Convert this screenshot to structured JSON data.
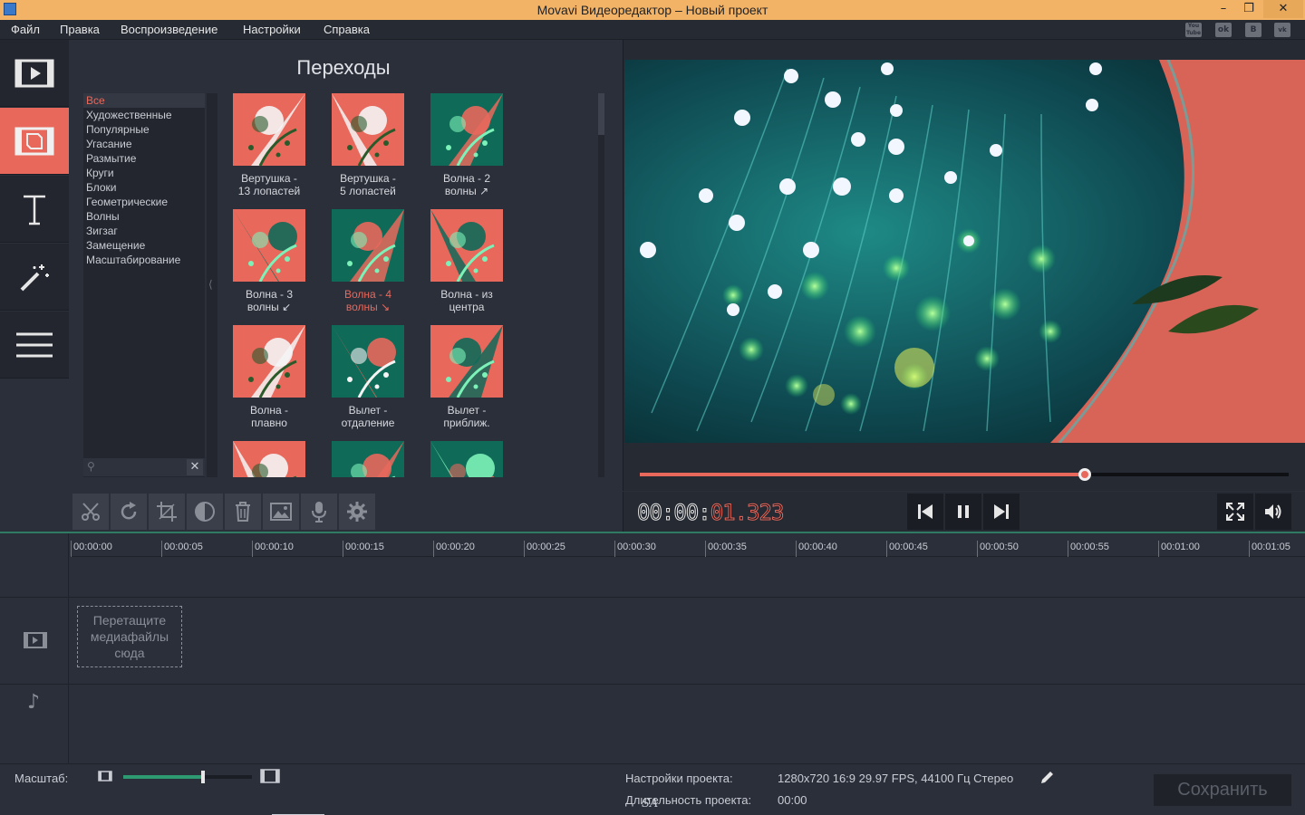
{
  "window": {
    "title": "Movavi Видеоредактор – Новый проект"
  },
  "menu": [
    "Файл",
    "Правка",
    "Воспроизведение",
    "Настройки",
    "Справка"
  ],
  "social": [
    "You Tube",
    "ok",
    "B",
    "vk"
  ],
  "tools": [
    {
      "name": "import",
      "icon": "film-strip-icon",
      "active": false
    },
    {
      "name": "transitions",
      "icon": "transitions-icon",
      "active": true
    },
    {
      "name": "titles",
      "icon": "text-t-icon",
      "active": false
    },
    {
      "name": "filters",
      "icon": "magic-wand-icon",
      "active": false
    },
    {
      "name": "more",
      "icon": "menu-lines-icon",
      "active": false
    }
  ],
  "panel": {
    "title": "Переходы",
    "categories": [
      "Все",
      "Художественные",
      "Популярные",
      "Угасание",
      "Размытие",
      "Круги",
      "Блоки",
      "Геометрические",
      "Волны",
      "Зигзаг",
      "Замещение",
      "Масштабирование"
    ],
    "selected_category": 0,
    "search_placeholder": "",
    "transitions": [
      {
        "label": "Вертушка -\n13 лопастей",
        "selected": false
      },
      {
        "label": "Вертушка -\n5 лопастей",
        "selected": false
      },
      {
        "label": "Волна - 2\nволны ↗",
        "selected": false
      },
      {
        "label": "Волна - 3\nволны ↙",
        "selected": false
      },
      {
        "label": "Волна - 4\nволны ↘",
        "selected": true
      },
      {
        "label": "Волна - из\nцентра",
        "selected": false
      },
      {
        "label": "Волна -\nплавно",
        "selected": false
      },
      {
        "label": "Вылет -\nотдаление",
        "selected": false
      },
      {
        "label": "Вылет -\nприближ.",
        "selected": false
      },
      {
        "label": "",
        "selected": false
      },
      {
        "label": "",
        "selected": false
      },
      {
        "label": "",
        "selected": false
      }
    ]
  },
  "player": {
    "timecode_dim": "00:00:",
    "timecode_hi": "01.323",
    "progress": 0.686
  },
  "timeline": {
    "ticks": [
      "00:00:00",
      "00:00:05",
      "00:00:10",
      "00:00:15",
      "00:00:20",
      "00:00:25",
      "00:00:30",
      "00:00:35",
      "00:00:40",
      "00:00:45",
      "00:00:50",
      "00:00:55",
      "00:01:00",
      "00:01:05"
    ],
    "drop_hint": "Перетащите\nмедиафайлы\nсюда"
  },
  "status": {
    "zoom_label": "Масштаб:",
    "zoom_level": 0.62,
    "settings_label": "Настройки проекта:",
    "settings_value": "1280x720 16:9 29.97 FPS, 44100 Гц Стерео",
    "duration_label": "Длительность проекта:",
    "duration_value": "00:00",
    "save_label": "Сохранить",
    "watermark": "SA"
  },
  "colors": {
    "accent": "#e8685c",
    "green": "#2e9a72",
    "bg": "#2b2f3a"
  }
}
